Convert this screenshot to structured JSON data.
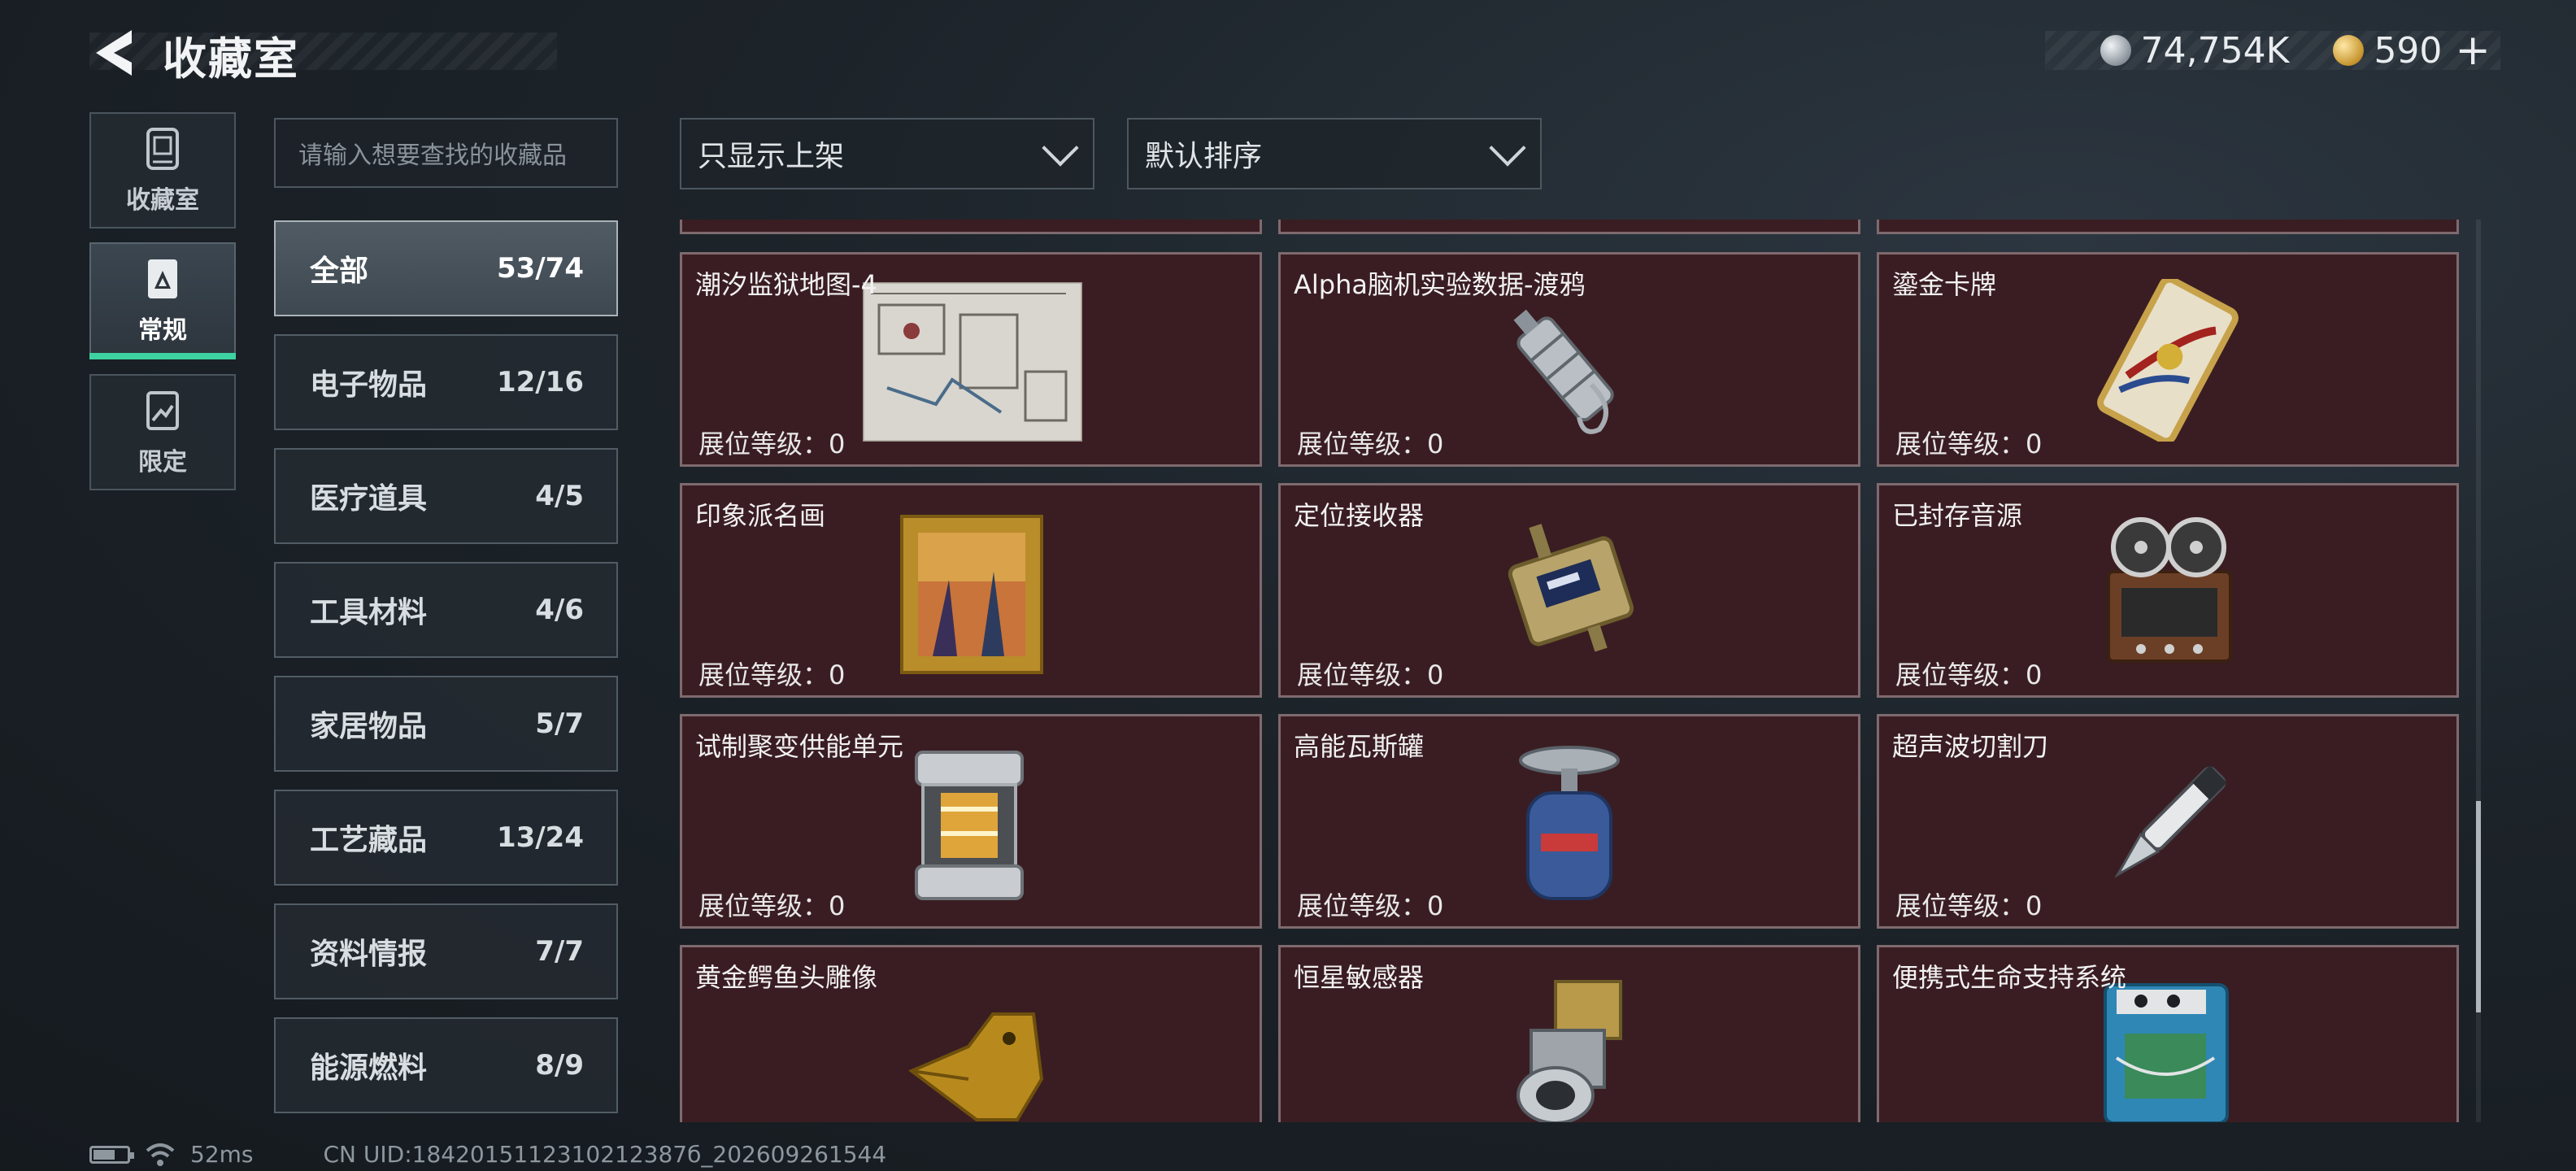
{
  "header": {
    "title": "收藏室",
    "currency": [
      {
        "icon": "silver-coin-icon",
        "value": "74,754K"
      },
      {
        "icon": "gold-coin-icon",
        "value": "590"
      }
    ],
    "add_symbol": "+"
  },
  "left_nav": [
    {
      "label": "收藏室",
      "icon": "collection-icon"
    },
    {
      "label": "常规",
      "icon": "regular-icon",
      "active": true
    },
    {
      "label": "限定",
      "icon": "limited-icon"
    }
  ],
  "search": {
    "placeholder": "请输入想要查找的收藏品"
  },
  "categories": [
    {
      "name": "全部",
      "count": "53/74",
      "active": true
    },
    {
      "name": "电子物品",
      "count": "12/16"
    },
    {
      "name": "医疗道具",
      "count": "4/5"
    },
    {
      "name": "工具材料",
      "count": "4/6"
    },
    {
      "name": "家居物品",
      "count": "5/7"
    },
    {
      "name": "工艺藏品",
      "count": "13/24"
    },
    {
      "name": "资料情报",
      "count": "7/7"
    },
    {
      "name": "能源燃料",
      "count": "8/9"
    }
  ],
  "filters": {
    "display": "只显示上架",
    "sort": "默认排序"
  },
  "items": [
    {
      "name": "潮汐监狱地图-4",
      "level_label": "展位等级：0",
      "icon": "prison-map-icon"
    },
    {
      "name": "Alpha脑机实验数据-渡鸦",
      "level_label": "展位等级：0",
      "icon": "data-drive-icon"
    },
    {
      "name": "鎏金卡牌",
      "level_label": "展位等级：0",
      "icon": "gilded-card-icon"
    },
    {
      "name": "印象派名画",
      "level_label": "展位等级：0",
      "icon": "painting-icon"
    },
    {
      "name": "定位接收器",
      "level_label": "展位等级：0",
      "icon": "locator-receiver-icon"
    },
    {
      "name": "已封存音源",
      "level_label": "展位等级：0",
      "icon": "reel-recorder-icon"
    },
    {
      "name": "试制聚变供能单元",
      "level_label": "展位等级：0",
      "icon": "fusion-cell-icon"
    },
    {
      "name": "高能瓦斯罐",
      "level_label": "展位等级：0",
      "icon": "gas-canister-icon"
    },
    {
      "name": "超声波切割刀",
      "level_label": "展位等级：0",
      "icon": "ultrasonic-knife-icon"
    },
    {
      "name": "黄金鳄鱼头雕像",
      "level_label": "展位等级：0",
      "icon": "gold-crocodile-icon"
    },
    {
      "name": "恒星敏感器",
      "level_label": "展位等级：0",
      "icon": "star-sensor-icon"
    },
    {
      "name": "便携式生命支持系统",
      "level_label": "展位等级：0",
      "icon": "life-support-icon"
    }
  ],
  "status_bar": {
    "ping": "52ms",
    "uid": "CN UID:1842015112310212387б_202609261544"
  }
}
